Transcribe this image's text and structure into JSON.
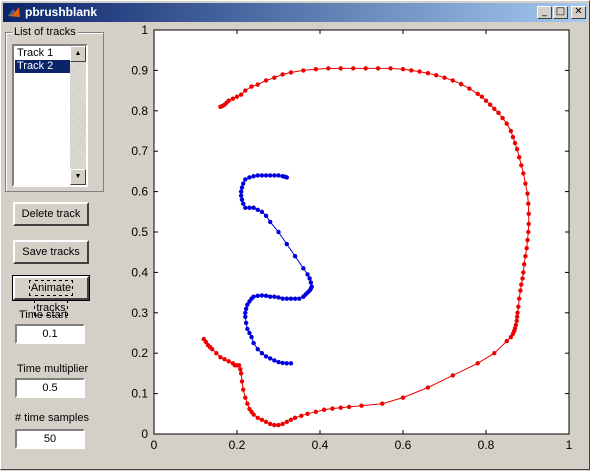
{
  "window": {
    "title": "pbrushblank",
    "minimize_glyph": "_",
    "maximize_glyph": "□",
    "close_glyph": "✕"
  },
  "tracks_panel": {
    "label": "List of tracks",
    "items": [
      "Track 1",
      "Track 2"
    ],
    "selected_index": 1,
    "scroll_up_glyph": "▲",
    "scroll_down_glyph": "▼"
  },
  "buttons": {
    "delete": "Delete track",
    "save": "Save tracks",
    "animate": "Animate tracks"
  },
  "fields": {
    "time_start_label": "Time start",
    "time_start_value": "0.1",
    "time_multiplier_label": "Time multiplier",
    "time_multiplier_value": "0.5",
    "time_samples_label": "# time samples",
    "time_samples_value": "50"
  },
  "colors": {
    "track1": "#ee0000",
    "track2": "#0000dd",
    "selection": "#0a246a"
  },
  "chart_data": {
    "type": "line",
    "title": "",
    "xlabel": "",
    "ylabel": "",
    "xlim": [
      0,
      1
    ],
    "ylim": [
      0,
      1
    ],
    "xticks": [
      "0",
      "0.2",
      "0.4",
      "0.6",
      "0.8",
      "1"
    ],
    "yticks": [
      "0",
      "0.1",
      "0.2",
      "0.3",
      "0.4",
      "0.5",
      "0.6",
      "0.7",
      "0.8",
      "0.9",
      "1"
    ],
    "series": [
      {
        "color": "#ee0000",
        "x": [
          0.16,
          0.165,
          0.17,
          0.175,
          0.18,
          0.19,
          0.2,
          0.21,
          0.22,
          0.235,
          0.25,
          0.27,
          0.29,
          0.31,
          0.33,
          0.36,
          0.39,
          0.42,
          0.45,
          0.48,
          0.51,
          0.54,
          0.57,
          0.6,
          0.62,
          0.64,
          0.66,
          0.68,
          0.7,
          0.72,
          0.74,
          0.76,
          0.78,
          0.79,
          0.8,
          0.81,
          0.82,
          0.83,
          0.84,
          0.85,
          0.86,
          0.865,
          0.87,
          0.875,
          0.88,
          0.885,
          0.89,
          0.895,
          0.9,
          0.902,
          0.903,
          0.903,
          0.902,
          0.9,
          0.898,
          0.895,
          0.892,
          0.89,
          0.888,
          0.885,
          0.883,
          0.88,
          0.878,
          0.876,
          0.875,
          0.874,
          0.872,
          0.87,
          0.868,
          0.865,
          0.86,
          0.85,
          0.82,
          0.78,
          0.72,
          0.66,
          0.6,
          0.55,
          0.5,
          0.47,
          0.45,
          0.43,
          0.41,
          0.39,
          0.37,
          0.355,
          0.34,
          0.33,
          0.32,
          0.31,
          0.3,
          0.29,
          0.28,
          0.27,
          0.26,
          0.25,
          0.24,
          0.235,
          0.23,
          0.225,
          0.22,
          0.215,
          0.212,
          0.21,
          0.208,
          0.205,
          0.2,
          0.195,
          0.19,
          0.18,
          0.17,
          0.16,
          0.15,
          0.14,
          0.135,
          0.13,
          0.125,
          0.12
        ],
        "y": [
          0.81,
          0.812,
          0.815,
          0.82,
          0.825,
          0.83,
          0.835,
          0.84,
          0.85,
          0.86,
          0.865,
          0.875,
          0.882,
          0.89,
          0.895,
          0.9,
          0.903,
          0.905,
          0.905,
          0.905,
          0.905,
          0.905,
          0.905,
          0.903,
          0.9,
          0.897,
          0.893,
          0.888,
          0.882,
          0.875,
          0.866,
          0.855,
          0.842,
          0.835,
          0.825,
          0.815,
          0.805,
          0.795,
          0.782,
          0.768,
          0.75,
          0.735,
          0.72,
          0.705,
          0.685,
          0.665,
          0.645,
          0.62,
          0.595,
          0.57,
          0.545,
          0.52,
          0.5,
          0.48,
          0.46,
          0.44,
          0.42,
          0.4,
          0.385,
          0.37,
          0.355,
          0.335,
          0.315,
          0.3,
          0.29,
          0.28,
          0.27,
          0.262,
          0.255,
          0.248,
          0.24,
          0.23,
          0.2,
          0.175,
          0.145,
          0.115,
          0.09,
          0.075,
          0.07,
          0.067,
          0.065,
          0.063,
          0.06,
          0.055,
          0.05,
          0.045,
          0.04,
          0.035,
          0.03,
          0.025,
          0.022,
          0.022,
          0.025,
          0.03,
          0.035,
          0.04,
          0.048,
          0.055,
          0.062,
          0.075,
          0.09,
          0.11,
          0.13,
          0.15,
          0.16,
          0.17,
          0.17,
          0.17,
          0.175,
          0.18,
          0.185,
          0.19,
          0.2,
          0.21,
          0.215,
          0.22,
          0.228,
          0.235
        ]
      },
      {
        "color": "#0000dd",
        "x": [
          0.32,
          0.315,
          0.31,
          0.3,
          0.29,
          0.28,
          0.27,
          0.26,
          0.25,
          0.24,
          0.23,
          0.22,
          0.215,
          0.212,
          0.21,
          0.21,
          0.212,
          0.215,
          0.22,
          0.23,
          0.24,
          0.25,
          0.26,
          0.27,
          0.28,
          0.3,
          0.32,
          0.34,
          0.36,
          0.37,
          0.375,
          0.378,
          0.38,
          0.378,
          0.375,
          0.37,
          0.365,
          0.36,
          0.35,
          0.34,
          0.33,
          0.32,
          0.31,
          0.3,
          0.29,
          0.28,
          0.27,
          0.26,
          0.25,
          0.24,
          0.235,
          0.23,
          0.225,
          0.222,
          0.22,
          0.22,
          0.222,
          0.225,
          0.23,
          0.235,
          0.24,
          0.25,
          0.26,
          0.27,
          0.28,
          0.29,
          0.3,
          0.31,
          0.32,
          0.33
        ],
        "y": [
          0.635,
          0.637,
          0.638,
          0.64,
          0.64,
          0.64,
          0.64,
          0.64,
          0.64,
          0.638,
          0.635,
          0.63,
          0.62,
          0.61,
          0.6,
          0.59,
          0.58,
          0.57,
          0.56,
          0.56,
          0.56,
          0.555,
          0.55,
          0.54,
          0.525,
          0.5,
          0.47,
          0.44,
          0.41,
          0.395,
          0.385,
          0.375,
          0.365,
          0.36,
          0.355,
          0.35,
          0.345,
          0.34,
          0.335,
          0.335,
          0.335,
          0.335,
          0.335,
          0.338,
          0.34,
          0.34,
          0.342,
          0.343,
          0.342,
          0.34,
          0.335,
          0.328,
          0.32,
          0.31,
          0.3,
          0.29,
          0.275,
          0.26,
          0.25,
          0.24,
          0.225,
          0.21,
          0.2,
          0.192,
          0.187,
          0.182,
          0.178,
          0.176,
          0.175,
          0.175
        ]
      }
    ]
  }
}
